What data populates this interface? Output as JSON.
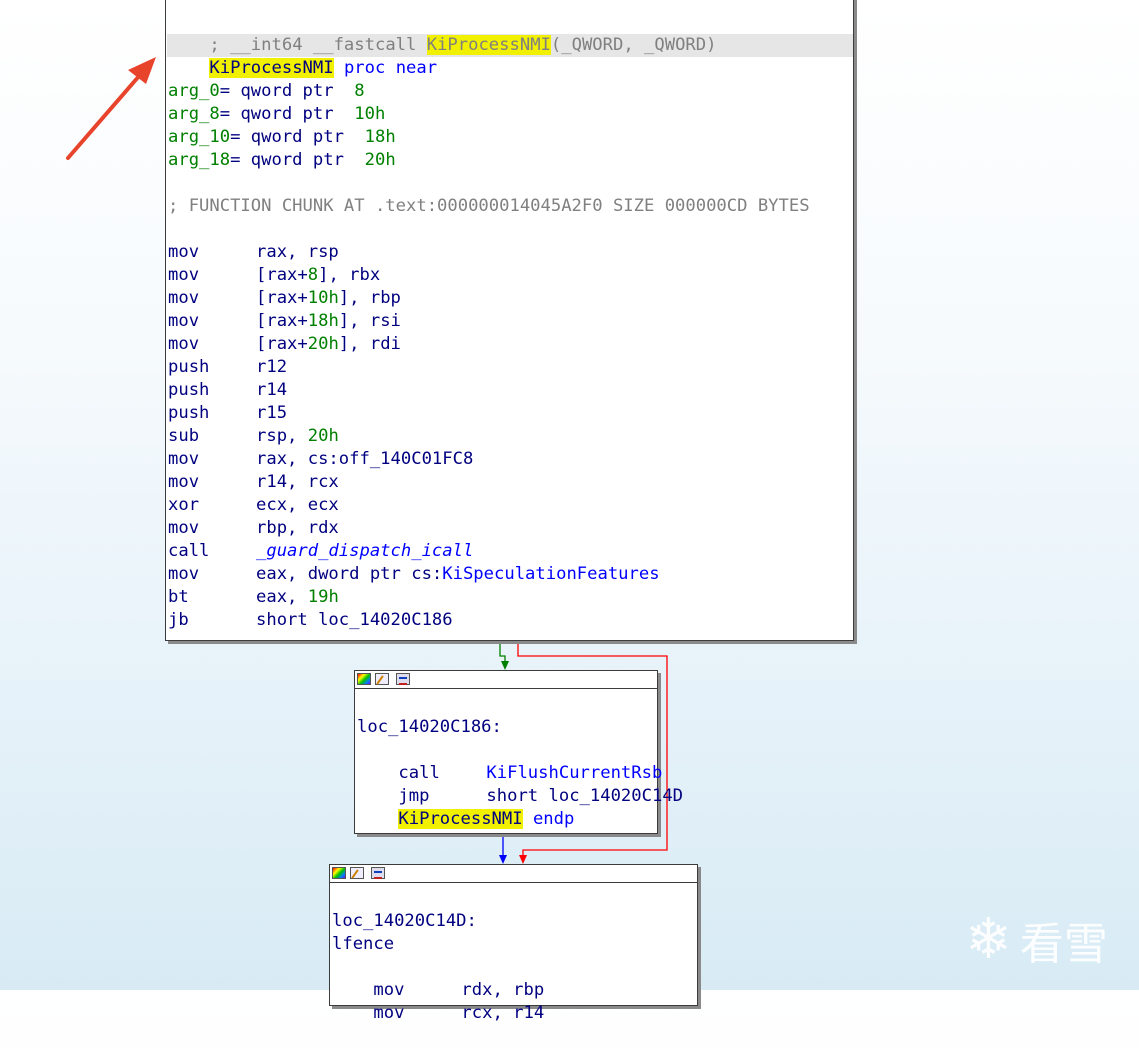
{
  "main_block": {
    "header_prefix": "; __int64 __fastcall ",
    "func_name": "KiProcessNMI",
    "header_suffix": "(_QWORD, _QWORD)",
    "proc_name": "KiProcessNMI",
    "proc_kw": "proc near",
    "args": [
      {
        "name": "arg_0",
        "decl": "= qword ptr  ",
        "val": "8"
      },
      {
        "name": "arg_8",
        "decl": "= qword ptr  ",
        "val": "10h"
      },
      {
        "name": "arg_10",
        "decl": "= qword ptr  ",
        "val": "18h"
      },
      {
        "name": "arg_18",
        "decl": "= qword ptr  ",
        "val": "20h"
      }
    ],
    "chunk_comment": "; FUNCTION CHUNK AT .text:000000014045A2F0 SIZE 000000CD BYTES",
    "instructions": [
      {
        "mn": "mov",
        "ops": "rax, rsp"
      },
      {
        "mn": "mov",
        "pre": "[rax+",
        "num": "8",
        "post": "], rbx"
      },
      {
        "mn": "mov",
        "pre": "[rax+",
        "num": "10h",
        "post": "], rbp"
      },
      {
        "mn": "mov",
        "pre": "[rax+",
        "num": "18h",
        "post": "], rsi"
      },
      {
        "mn": "mov",
        "pre": "[rax+",
        "num": "20h",
        "post": "], rdi"
      },
      {
        "mn": "push",
        "ops": "r12"
      },
      {
        "mn": "push",
        "ops": "r14"
      },
      {
        "mn": "push",
        "ops": "r15"
      },
      {
        "mn": "sub",
        "pre": "rsp, ",
        "num": "20h",
        "post": ""
      },
      {
        "mn": "mov",
        "ops": "rax, cs:off_140C01FC8"
      },
      {
        "mn": "mov",
        "ops": "r14, rcx"
      },
      {
        "mn": "xor",
        "ops": "ecx, ecx"
      },
      {
        "mn": "mov",
        "ops": "rbp, rdx"
      },
      {
        "mn": "call",
        "ital": "_guard_dispatch_icall"
      },
      {
        "mn": "mov",
        "pre": "eax, dword ptr cs:",
        "sym": "KiSpeculationFeatures"
      },
      {
        "mn": "bt",
        "pre": "eax, ",
        "num": "19h",
        "post": ""
      },
      {
        "mn": "jb",
        "ops": "short loc_14020C186"
      }
    ]
  },
  "block2": {
    "label": "loc_14020C186:",
    "call_mn": "call",
    "call_target": "KiFlushCurrentRsb",
    "jmp_mn": "jmp",
    "jmp_target": "short loc_14020C14D",
    "endp_name": "KiProcessNMI",
    "endp_kw": "endp"
  },
  "block3": {
    "label": "loc_14020C14D:",
    "l1": "lfence",
    "l2_mn": "mov",
    "l2_ops": "rdx, rbp",
    "l3_mn": "mov",
    "l3_ops": "rcx, r14"
  },
  "watermark": {
    "text": "看雪"
  },
  "colors": {
    "highlight": "#f0f000",
    "edge_true": "#008000",
    "edge_false": "#ff0000",
    "edge_normal": "#0000ff",
    "arrow": "#e8442c"
  }
}
